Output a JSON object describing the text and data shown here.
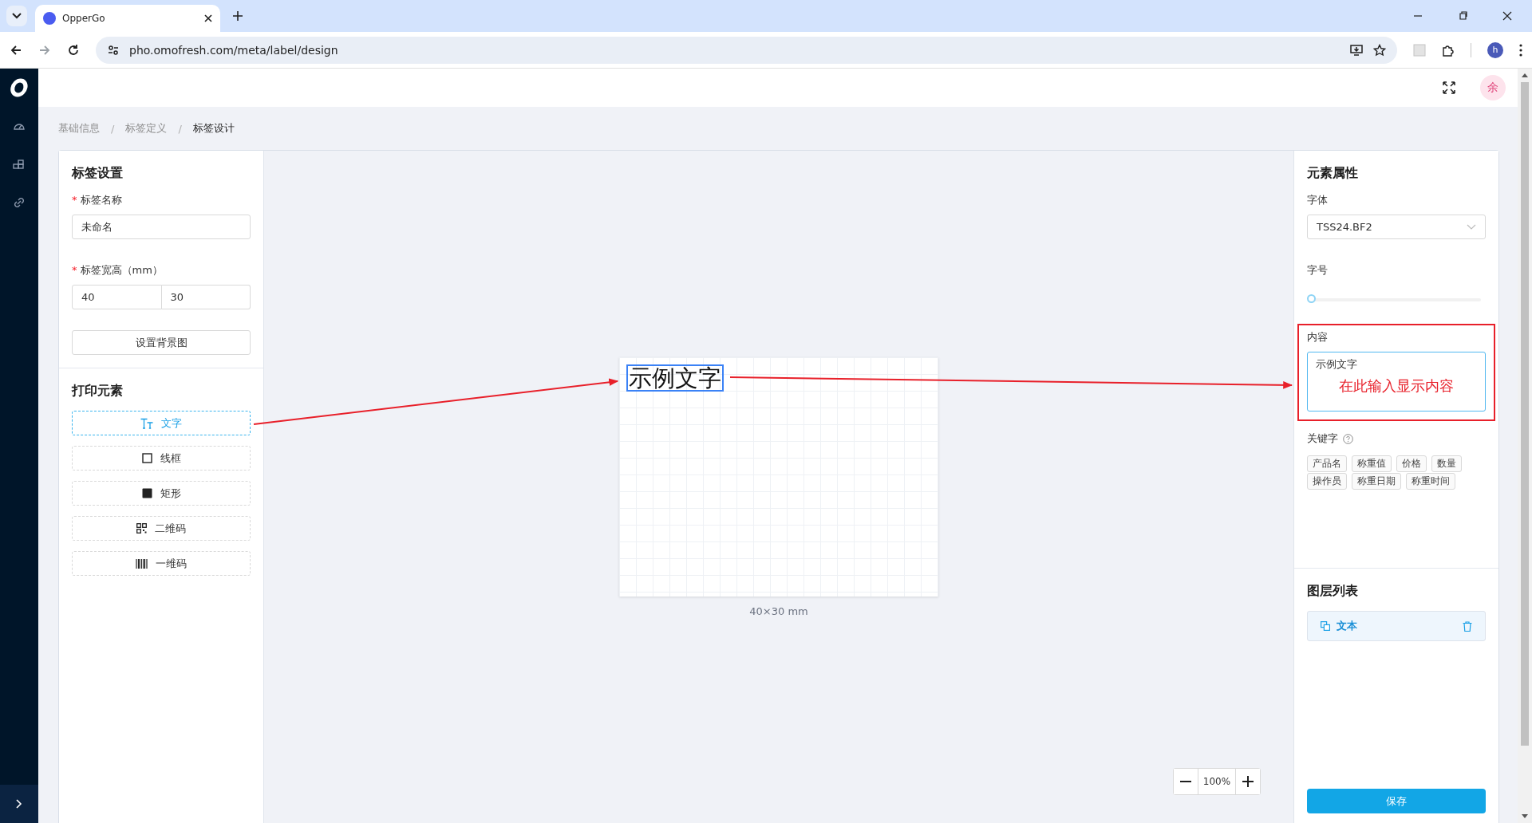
{
  "browser": {
    "tab_title": "OpperGo",
    "url": "pho.omofresh.com/meta/label/design",
    "profile_initial": "h"
  },
  "header": {
    "user_initial": "余"
  },
  "breadcrumb": [
    {
      "label": "基础信息",
      "current": false
    },
    {
      "separator": "/",
      "label": "标签定义",
      "current": false
    },
    {
      "separator": "/",
      "label": "标签设计",
      "current": true
    }
  ],
  "label_settings": {
    "title": "标签设置",
    "name_required": "*",
    "name_label": "标签名称",
    "size_required": "*",
    "name_value": "未命名",
    "size_label": "标签宽高（mm）",
    "width_value": "40",
    "height_value": "30",
    "background_button": "设置背景图"
  },
  "print_elements": {
    "title": "打印元素",
    "items": [
      {
        "kind": "text",
        "label": "文字",
        "selected": true
      },
      {
        "kind": "frame",
        "label": "线框",
        "selected": false
      },
      {
        "kind": "rect",
        "label": "矩形",
        "selected": false
      },
      {
        "kind": "qrcode",
        "label": "二维码",
        "selected": false
      },
      {
        "kind": "barcode",
        "label": "一维码",
        "selected": false
      }
    ]
  },
  "canvas": {
    "element_text": "示例文字",
    "element_selected": true,
    "size_caption": "40×30 mm",
    "zoom": "100%"
  },
  "properties": {
    "title": "元素属性",
    "font_label": "字体",
    "font_value": "TSS24.BF2",
    "size_label": "字号",
    "size_slider": {
      "level": 0
    },
    "content_label": "内容",
    "content_value": "示例文字",
    "keywords_label": "关键字",
    "keywords": [
      "产品名",
      "称重值",
      "价格",
      "数量",
      "操作员",
      "称重日期",
      "称重时间"
    ]
  },
  "annotation": {
    "text": "在此输入显示内容"
  },
  "layers": {
    "title": "图层列表",
    "items": [
      {
        "label": "文本",
        "selected": true
      }
    ]
  },
  "save_button": "保存"
}
